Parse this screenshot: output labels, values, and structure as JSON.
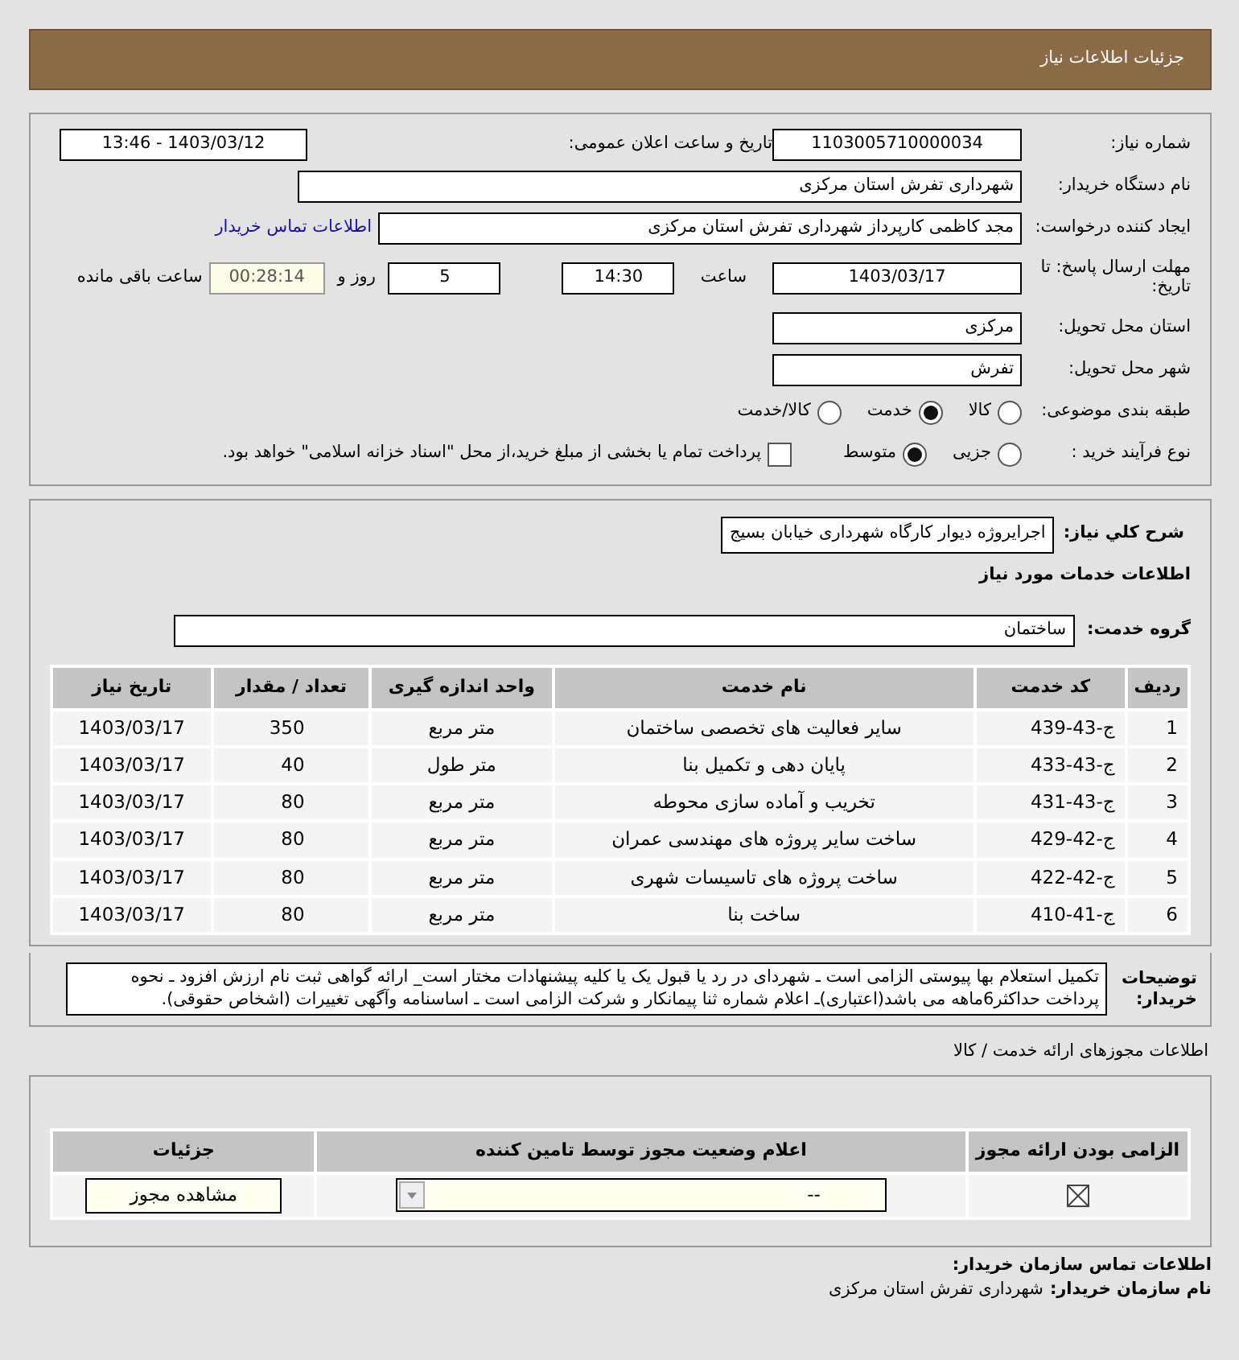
{
  "header": {
    "title": "جزئیات اطلاعات نیاز"
  },
  "need_number": {
    "label": "شماره نیاز:",
    "value": "1103005710000034"
  },
  "announce": {
    "label": "تاریخ و ساعت اعلان عمومی:",
    "value": "1403/03/12 - 13:46"
  },
  "buyer_org": {
    "label": "نام دستگاه خریدار:",
    "value": "شهرداری تفرش استان مرکزی"
  },
  "requester": {
    "label": "ایجاد کننده درخواست:",
    "value": "مجد کاظمی کارپرداز شهرداری تفرش استان مرکزی",
    "link": "اطلاعات تماس خریدار"
  },
  "deadline": {
    "label": "مهلت ارسال پاسخ: تا تاریخ:",
    "date": "1403/03/17",
    "time_label": "ساعت",
    "time": "14:30",
    "days": "5",
    "days_label": "روز و",
    "remaining": "00:28:14",
    "remaining_label": "ساعت باقی مانده"
  },
  "province": {
    "label": "استان محل تحویل:",
    "value": "مرکزی"
  },
  "city": {
    "label": "شهر محل تحویل:",
    "value": "تفرش"
  },
  "category": {
    "label": "طبقه بندی موضوعی:",
    "options": [
      {
        "label": "کالا",
        "selected": false
      },
      {
        "label": "خدمت",
        "selected": true
      },
      {
        "label": "کالا/خدمت",
        "selected": false
      }
    ]
  },
  "process": {
    "label": "نوع فرآیند خرید :",
    "options": [
      {
        "label": "جزیی",
        "selected": false
      },
      {
        "label": "متوسط",
        "selected": true
      }
    ],
    "checkbox": {
      "label": "پرداخت تمام یا بخشی از مبلغ خرید،از محل \"اسناد خزانه اسلامی\" خواهد بود.",
      "checked": false
    }
  },
  "summary": {
    "label": "شرح کلي نياز:",
    "value": "اجرایروژه دیوار کارگاه شهرداری خیابان بسیج"
  },
  "services_title": "اطلاعات خدمات مورد نیاز",
  "service_group": {
    "label": "گروه خدمت:",
    "value": "ساختمان"
  },
  "table": {
    "columns": [
      "ردیف",
      "کد خدمت",
      "نام خدمت",
      "واحد اندازه گیری",
      "تعداد / مقدار",
      "تاریخ نیاز"
    ],
    "rows": [
      [
        "1",
        "ج-43-439",
        "سایر فعالیت های تخصصی ساختمان",
        "متر مربع",
        "350",
        "1403/03/17"
      ],
      [
        "2",
        "ج-43-433",
        "پایان دهی و تکمیل بنا",
        "متر طول",
        "40",
        "1403/03/17"
      ],
      [
        "3",
        "ج-43-431",
        "تخریب و آماده سازی محوطه",
        "متر مربع",
        "80",
        "1403/03/17"
      ],
      [
        "4",
        "ج-42-429",
        "ساخت سایر پروژه های مهندسی عمران",
        "متر مربع",
        "80",
        "1403/03/17"
      ],
      [
        "5",
        "ج-42-422",
        "ساخت پروژه های تاسیسات شهری",
        "متر مربع",
        "80",
        "1403/03/17"
      ],
      [
        "6",
        "ج-41-410",
        "ساخت بنا",
        "متر مربع",
        "80",
        "1403/03/17"
      ]
    ]
  },
  "buyer_notes": {
    "label": "توضیحات خریدار:",
    "value": "تکمیل استعلام بها پیوستی الزامی است ـ شهردای در رد یا قبول یک یا کلیه پیشنهادات مختار است_ ارائه گواهی ثبت نام ارزش افزود ـ نحوه پرداخت حداکثر6ماهه می باشد(اعتباری)ـ اعلام شماره ثنا پیمانکار و شرکت الزامی است ـ اساسنامه وآگهی تغییرات (اشخاص حقوقی)."
  },
  "permits": {
    "title": "اطلاعات مجوزهای ارائه خدمت / کالا",
    "columns": [
      "الزامی بودن ارائه مجوز",
      "اعلام وضعیت مجوز توسط تامین کننده",
      "جزئیات"
    ],
    "rows": [
      {
        "required": true,
        "status": "--",
        "button": "مشاهده مجوز"
      }
    ]
  },
  "contact": {
    "title": "اطلاعات تماس سازمان خریدار:",
    "org_label": "نام سازمان خریدار:",
    "org_value": "شهرداری تفرش استان مرکزی"
  }
}
